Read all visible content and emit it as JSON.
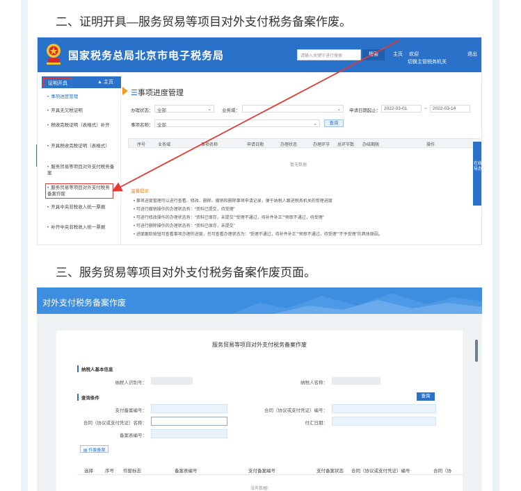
{
  "article": {
    "heading_1": "二、证明开具—服务贸易等项目对外支付税务备案作废。",
    "heading_2": "三、服务贸易等项目对外支付税务备案作废页面。"
  },
  "portal": {
    "title": "国家税务总局北京市电子税务局",
    "emblem_icon": "tax-emblem-icon",
    "header_search_placeholder": "请输入关键字进行搜索",
    "header_search_button": "搜索",
    "home_link": "主页",
    "welcome_text": "欢迎",
    "switch_tax_authority": "切换主管税务机关",
    "exit_link": "退出",
    "colors": {
      "header_blue": "#2a72c9",
      "highlight_red": "#e53935"
    }
  },
  "sidebar": {
    "tab_label": "证明开具",
    "home_label": "主页",
    "items": [
      {
        "label": "事项进度管理",
        "active": true
      },
      {
        "label": "开具无欠税证明"
      },
      {
        "label": "税收完税证明（表格式）补开"
      },
      {
        "label": "开具税收完税证明（表格式）"
      },
      {
        "label": "服务贸易等项目对外支付税务备案"
      },
      {
        "label": "服务贸易等项目对外支付税务备案作废",
        "highlighted": true
      },
      {
        "label": "开具中央非税收入统一票据"
      },
      {
        "label": "补开中央非税收入统一票据"
      }
    ]
  },
  "progress_page": {
    "title": "事项进度管理",
    "filters": {
      "status_label": "办理状态：",
      "status_value": "全部",
      "business_label": "业务域：",
      "business_value": "",
      "date_label": "申请日期起止：",
      "date_from": "2022-03-01",
      "date_sep": "~",
      "date_to": "2022-03-14",
      "item_label": "事项名称：",
      "item_value": "全部",
      "query_button": "查询"
    },
    "table_headers": [
      "序号",
      "业务域",
      "事项名称",
      "申请日期",
      "办理状态",
      "办理环节",
      "总环节数",
      "办结期限",
      "操作"
    ],
    "empty_text": "暂无数据",
    "tips_title": "温馨提示",
    "tips": [
      "事项进度管理可以进行查看、修改、删除、撤销和删除事项申请记录，便于纳税人跟进税务机关的受理进度",
      "可进行撤销操作的办理状态有：“资料已提交，待受理”",
      "可进行修改操作的办理状态有：“资料已保存，未提交”“受理不通过，待补件补正”“预审不通过，待受理”",
      "可进行删除操作的办理状态有：“资料已保存，未提交”",
      "进度跟踪按钮可查看事项办理的进度，也可查看办理状态为：“受理不通过，待补件补正”“预审不通过，待受理”“不予受理”的具体原因。"
    ],
    "float_service": "在线导办"
  },
  "cancel_page": {
    "header_title": "对外支付税务备案作废",
    "form_title": "服务贸易等项目对外支付税务备案作废",
    "taxpayer_section": "纳税人基本信息",
    "taxpayer_id_label": "纳税人识别号：",
    "taxpayer_name_label": "纳税人名称：",
    "query_section": "查询条件",
    "query_button": "查询",
    "payment_record_no_label": "支付备案编号：",
    "contract_no_label": "合同（协议或支付凭证）编号：",
    "contract_name_label": "合同（协议或支付凭证）名称：",
    "payment_date_label": "付汇日期：",
    "record_form_no_label": "备案表编号：",
    "void_record_button": "作废备案",
    "table_headers": [
      "选择",
      "序号",
      "作废标志",
      "备案表编号",
      "支付备案编号",
      "支付备案状态",
      "合同（协议或支付凭证）编号",
      "合同（协"
    ],
    "empty_text": "没有数据!"
  }
}
